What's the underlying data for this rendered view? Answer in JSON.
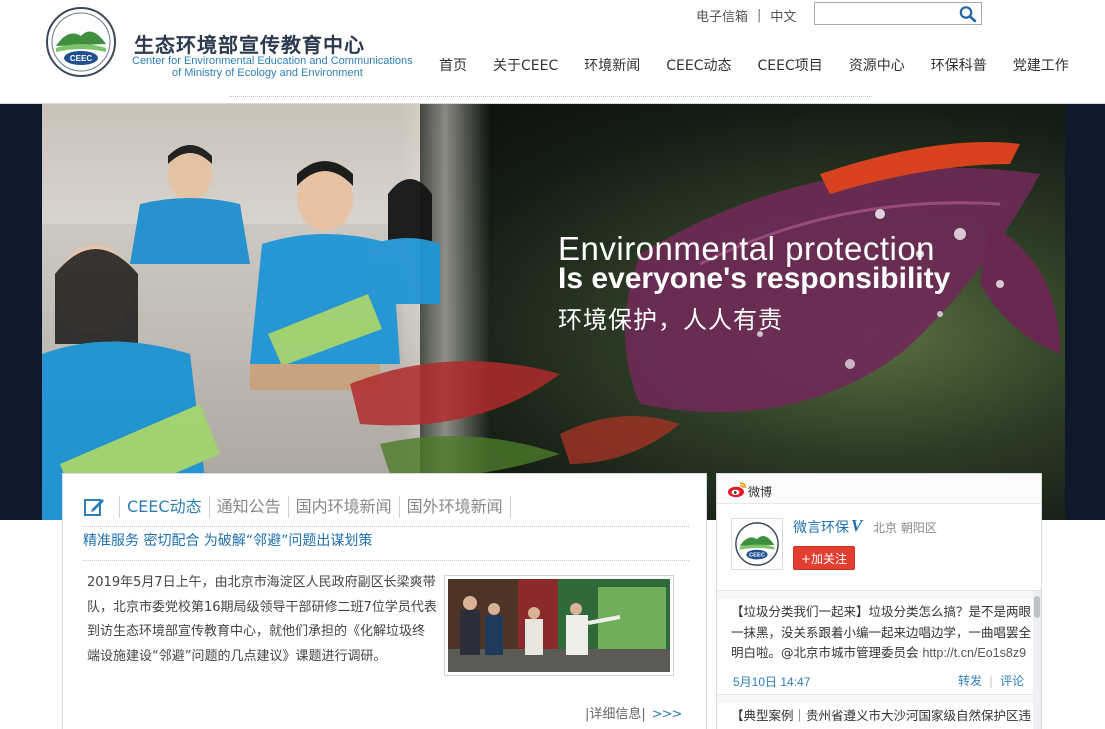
{
  "header": {
    "cn_name": "生态环境部宣传教育中心",
    "en_name_line1": "Center for Environmental Education and Communications",
    "en_name_line2": "of  Ministry of Ecology and Environment",
    "logo_label": "CEEC",
    "top_links": {
      "email": "电子信箱",
      "separator": "|",
      "language": "中文"
    },
    "search": {
      "placeholder": "",
      "icon": "search-icon"
    },
    "nav": [
      {
        "label": "首页"
      },
      {
        "label": "关于CEEC"
      },
      {
        "label": "环境新闻"
      },
      {
        "label": "CEEC动态"
      },
      {
        "label": "CEEC项目"
      },
      {
        "label": "资源中心"
      },
      {
        "label": "环保科普"
      },
      {
        "label": "党建工作"
      }
    ]
  },
  "banner": {
    "line1": "Environmental protection",
    "line2": "Is everyone's responsibility",
    "line3": "环境保护，人人有责"
  },
  "news": {
    "tabs": [
      {
        "label": "CEEC动态",
        "active": true
      },
      {
        "label": "通知公告",
        "active": false
      },
      {
        "label": "国内环境新闻",
        "active": false
      },
      {
        "label": "国外环境新闻",
        "active": false
      }
    ],
    "headline": "精准服务 密切配合 为破解“邻避”问题出谋划策",
    "summary": "2019年5月7日上午，由北京市海淀区人民政府副区长梁爽带队，北京市委党校第16期局级领导干部研修二班7位学员代表到访生态环境部宣传教育中心，就他们承担的《化解垃圾终端设施建设“邻避”问题的几点建议》课题进行调研。",
    "more_label": "|详细信息|",
    "more_arrows": ">>>"
  },
  "weibo": {
    "title": "微博",
    "account_name": "微言环保",
    "verified_mark": "V",
    "location": "北京 朝阳区",
    "follow_label": "+加关注",
    "posts": [
      {
        "text": "【垃圾分类我们一起来】垃圾分类怎么搞？是不是两眼一抹黑，没关系跟着小编一起来边唱边学，一曲唱罢全明白啦。@北京市城市管理委员会 ",
        "link": "http://t.cn/Eo1s8z9",
        "time": "5月10日 14:47",
        "repost": "转发",
        "action_sep": "|",
        "comment": "评论"
      },
      {
        "text": "【典型案例｜贵州省遵义市大沙河国家级自然保护区违"
      }
    ]
  },
  "colors": {
    "accent_blue": "#2e7fb8",
    "headline_blue": "#1f6fae",
    "follow_red": "#e33e32"
  }
}
